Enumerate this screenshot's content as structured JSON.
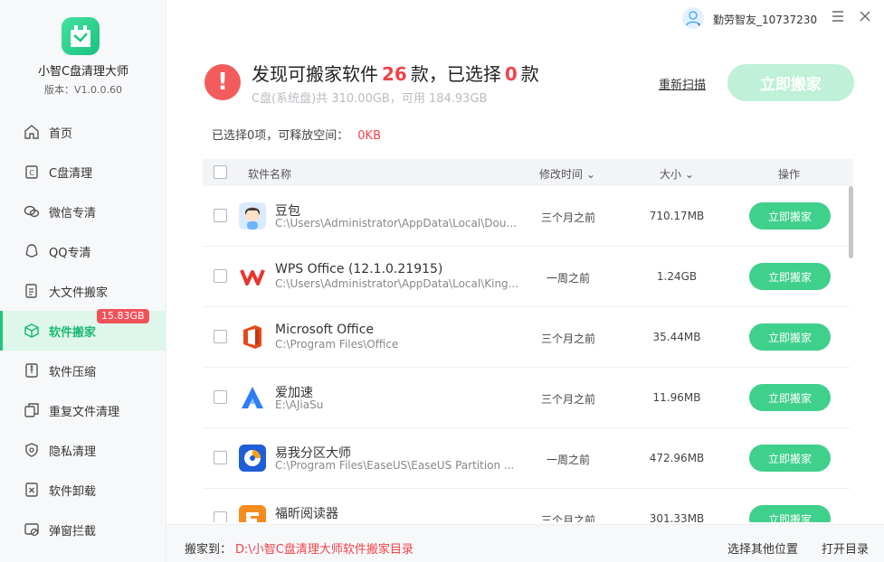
{
  "app": {
    "name": "小智C盘清理大师",
    "version": "版本：V1.0.0.60"
  },
  "user": {
    "name": "勤劳智友_10737230"
  },
  "nav": [
    {
      "id": "home",
      "label": "首页",
      "icon": "home-icon"
    },
    {
      "id": "c-clean",
      "label": "C盘清理",
      "icon": "c-drive-icon"
    },
    {
      "id": "wechat",
      "label": "微信专清",
      "icon": "wechat-icon"
    },
    {
      "id": "qq",
      "label": "QQ专清",
      "icon": "qq-icon"
    },
    {
      "id": "bigfile",
      "label": "大文件搬家",
      "icon": "file-move-icon"
    },
    {
      "id": "software-move",
      "label": "软件搬家",
      "icon": "box-icon",
      "badge": "15.83GB",
      "active": true
    },
    {
      "id": "compress",
      "label": "软件压缩",
      "icon": "compress-icon"
    },
    {
      "id": "duplicate",
      "label": "重复文件清理",
      "icon": "duplicate-icon"
    },
    {
      "id": "privacy",
      "label": "隐私清理",
      "icon": "shield-icon"
    },
    {
      "id": "uninstall",
      "label": "软件卸载",
      "icon": "uninstall-icon"
    },
    {
      "id": "popup",
      "label": "弹窗拦截",
      "icon": "block-icon"
    }
  ],
  "header": {
    "found_prefix": "发现可搬家软件",
    "found_count": "26",
    "found_mid": "款，已选择",
    "selected_count": "0",
    "found_suffix": "款",
    "disk_info": "C盘(系统盘)共 310.00GB，可用 184.93GB",
    "rescan_label": "重新扫描",
    "move_all_label": "立即搬家",
    "selection_info": "已选择0项，可释放空间：",
    "selection_size": "0KB"
  },
  "table": {
    "columns": {
      "name": "软件名称",
      "time": "修改时间",
      "size": "大小",
      "action": "操作"
    },
    "rows": [
      {
        "name": "豆包",
        "path": "C:\\Users\\Administrator\\AppData\\Local\\Dou...",
        "time": "三个月之前",
        "size": "710.17MB",
        "action": "立即搬家",
        "icon": "doubao-icon"
      },
      {
        "name": "WPS Office (12.1.0.21915)",
        "path": "C:\\Users\\Administrator\\AppData\\Local\\King...",
        "time": "一周之前",
        "size": "1.24GB",
        "action": "立即搬家",
        "icon": "wps-icon"
      },
      {
        "name": "Microsoft Office",
        "path": "C:\\Program Files\\Office",
        "time": "三个月之前",
        "size": "35.44MB",
        "action": "立即搬家",
        "icon": "office-icon"
      },
      {
        "name": "爱加速",
        "path": "E:\\AJiaSu",
        "time": "三个月之前",
        "size": "11.96MB",
        "action": "立即搬家",
        "icon": "ajiasu-icon"
      },
      {
        "name": "易我分区大师",
        "path": "C:\\Program Files\\EaseUS\\EaseUS Partition ...",
        "time": "一周之前",
        "size": "472.96MB",
        "action": "立即搬家",
        "icon": "easeus-icon"
      },
      {
        "name": "福昕阅读器",
        "path": "",
        "time": "三个月之前",
        "size": "301.33MB",
        "action": "立即搬家",
        "icon": "foxit-icon"
      }
    ]
  },
  "footer": {
    "label": "搬家到：",
    "path": "D:\\小智C盘清理大师软件搬家目录",
    "choose_label": "选择其他位置",
    "open_label": "打开目录"
  },
  "colors": {
    "accent": "#3fd08b",
    "danger": "#f0434a",
    "active_bg": "#dff6ea"
  }
}
